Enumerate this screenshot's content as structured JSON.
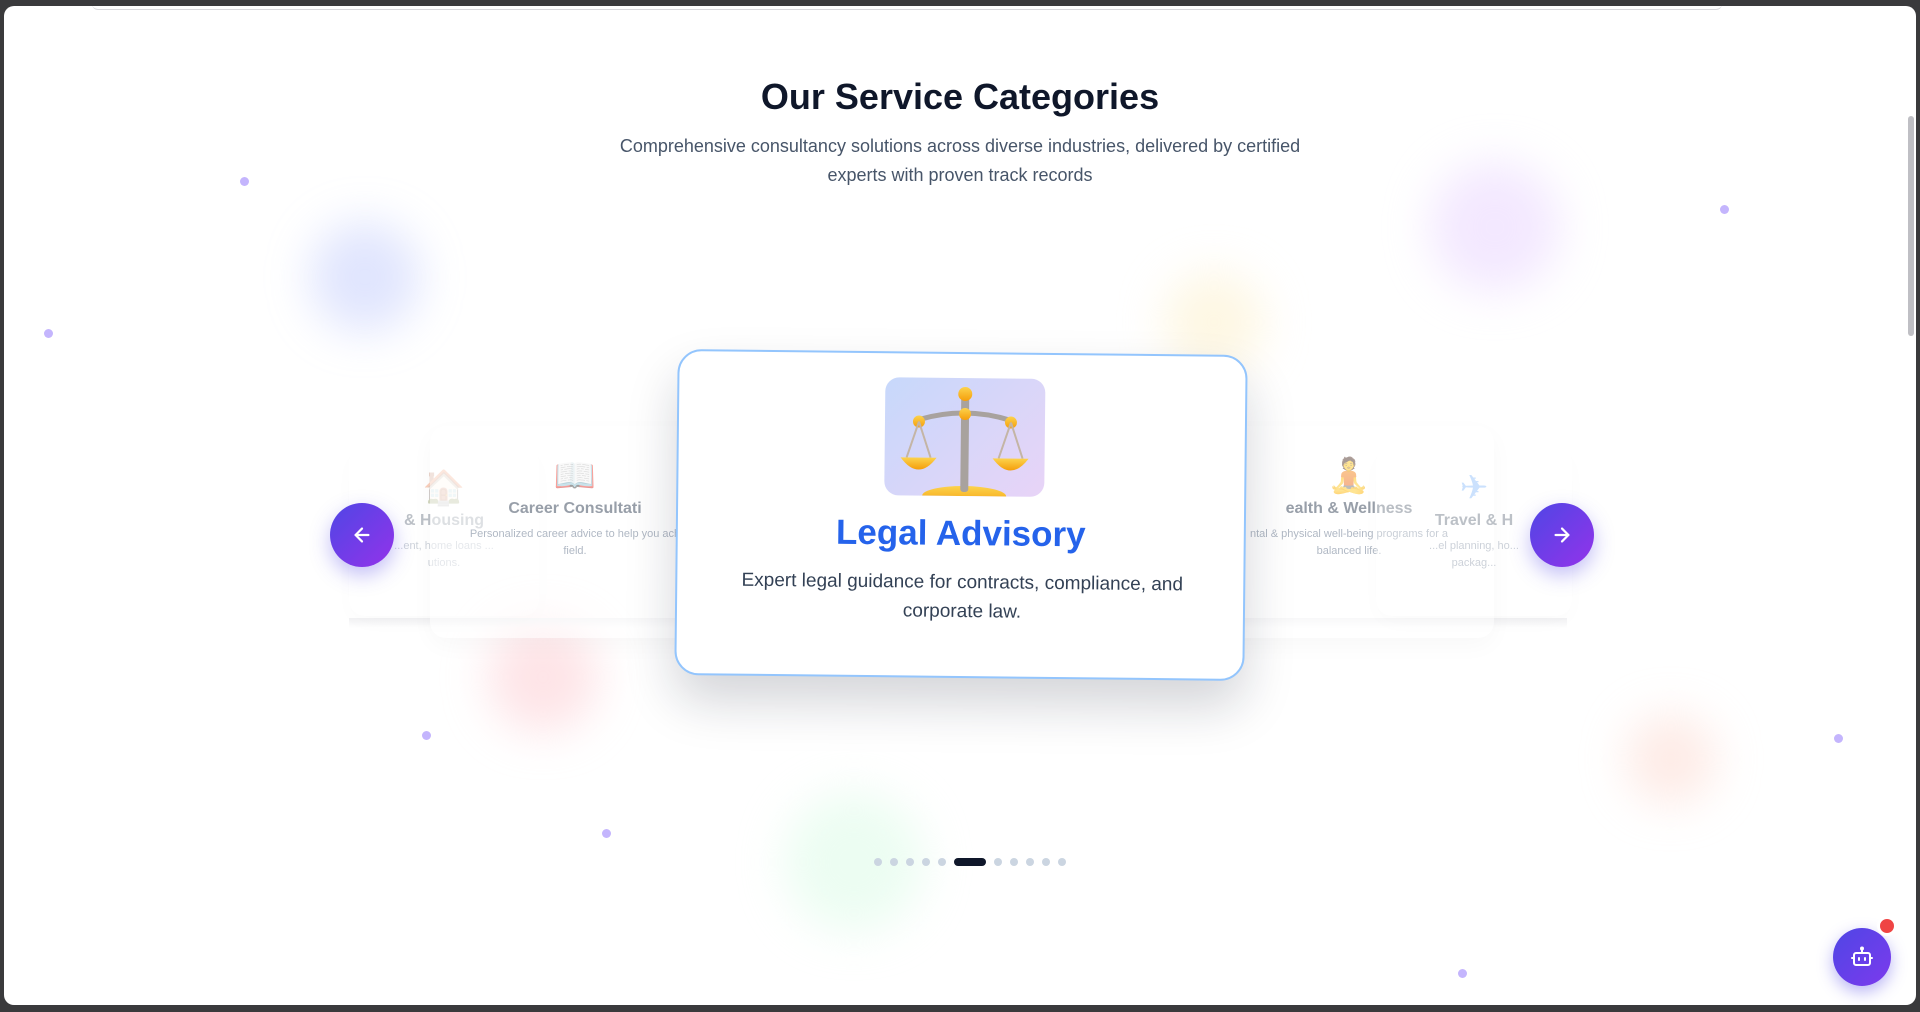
{
  "section": {
    "title": "Our Service Categories",
    "subtitle": "Comprehensive consultancy solutions across diverse industries, delivered by certified experts with proven track records"
  },
  "carousel": {
    "active": {
      "title": "Legal Advisory",
      "description": "Expert legal guidance for contracts, compliance, and corporate law.",
      "icon": "scales-of-justice-icon"
    },
    "cards": [
      {
        "title": "& Housing",
        "description": "...ent, home loans ... utions.",
        "icon": "house-icon",
        "glyph": "🏠"
      },
      {
        "title": "Career Consultati",
        "description": "Personalized career advice to help you ach field.",
        "icon": "book-icon",
        "glyph": "📖"
      },
      {
        "title": "ealth & Wellness",
        "description": "ntal & physical well-being programs for a balanced life.",
        "icon": "person-icon",
        "glyph": "🧘"
      },
      {
        "title": "Travel & H",
        "description": "...el planning, ho... packag...",
        "icon": "airplane-icon",
        "glyph": "✈"
      }
    ],
    "prev_label": "Previous",
    "next_label": "Next",
    "indicator_count": 11,
    "active_index": 5
  },
  "chat": {
    "icon": "bot-icon",
    "badge_color": "#ef4444"
  },
  "colors": {
    "accent": "#2563eb",
    "nav_gradient_start": "#4f46e5",
    "nav_gradient_end": "#9333ea",
    "card_border": "#93c5fd"
  }
}
